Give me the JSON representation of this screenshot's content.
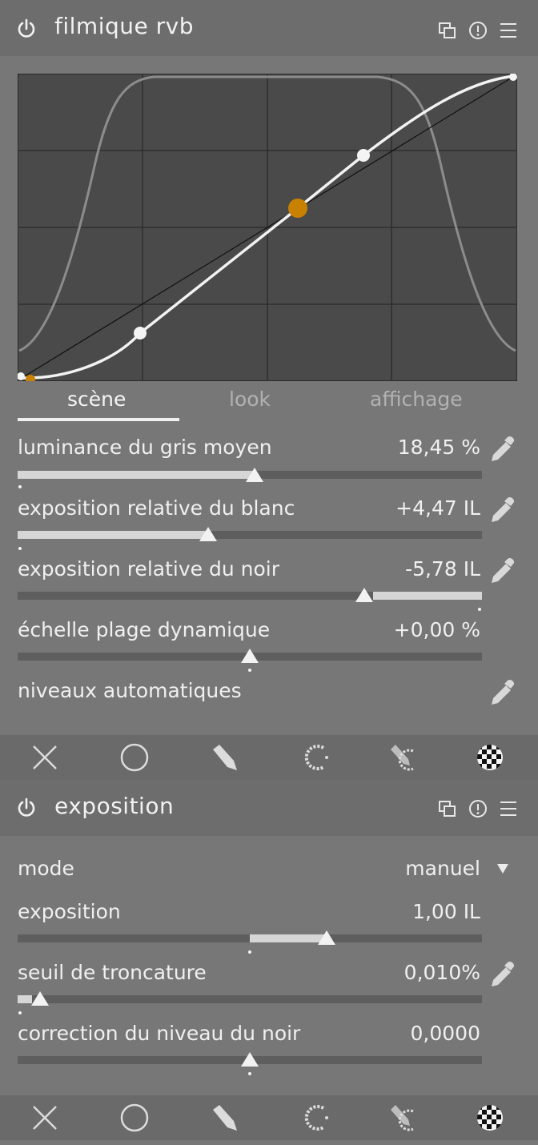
{
  "modules": [
    {
      "title": "filmique rvb",
      "tabs": [
        "scène",
        "look",
        "affichage"
      ],
      "active_tab": "scène",
      "sliders": [
        {
          "label": "luminance du gris moyen",
          "value": "18,45 %"
        },
        {
          "label": "exposition relative du blanc",
          "value": "+4,47 IL"
        },
        {
          "label": "exposition relative du noir",
          "value": "-5,78 IL"
        },
        {
          "label": "échelle plage dynamique",
          "value": "+0,00 %"
        }
      ],
      "auto_levels_label": "niveaux automatiques"
    },
    {
      "title": "exposition",
      "mode_label": "mode",
      "mode_value": "manuel",
      "sliders": [
        {
          "label": "exposition",
          "value": "1,00 IL"
        },
        {
          "label": "seuil de troncature",
          "value": "0,010%"
        },
        {
          "label": "correction du niveau du noir",
          "value": "0,0000"
        }
      ]
    }
  ],
  "colors": {
    "accent_orange": "#c98200",
    "curve": "#f2f2f2",
    "graph_bg": "#4a4a4a",
    "header_bg": "#6d6d6d",
    "panel_bg": "#777777"
  },
  "icons": [
    "power-icon",
    "presets-icon",
    "info-icon",
    "menu-icon",
    "color-picker-icon",
    "close-icon",
    "circle-mask-icon",
    "drawn-mask-icon",
    "parametric-mask-icon",
    "drawn-parametric-mask-icon",
    "raster-mask-icon",
    "dropdown-arrow-icon"
  ]
}
